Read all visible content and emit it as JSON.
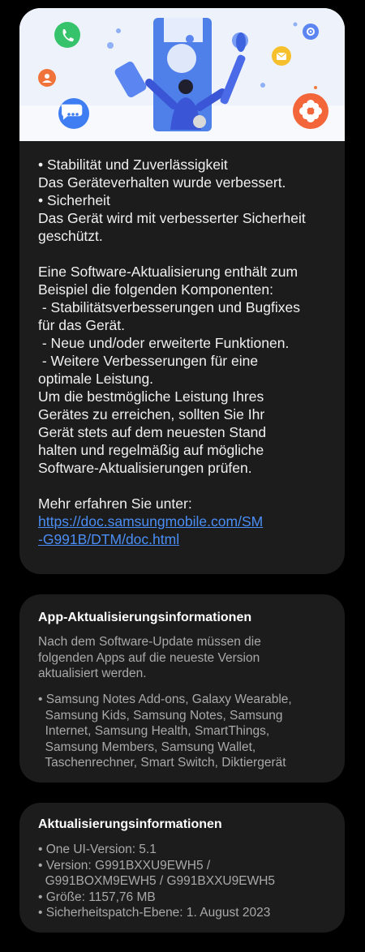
{
  "notes": {
    "lines": [
      "• Stabilität und Zuverlässigkeit",
      "Das Geräteverhalten wurde verbessert.",
      "• Sicherheit",
      "Das Gerät wird mit verbesserter Sicherheit",
      "geschützt.",
      "",
      "Eine Software-Aktualisierung enthält zum",
      "Beispiel die folgenden Komponenten:",
      " - Stabilitätsverbesserungen und Bugfixes",
      "für das Gerät.",
      " - Neue und/oder erweiterte Funktionen.",
      " - Weitere Verbesserungen für eine",
      "optimale Leistung.",
      "Um die bestmögliche Leistung Ihres",
      "Gerätes zu erreichen, sollten Sie Ihr",
      "Gerät stets auf dem neuesten Stand",
      "halten und regelmäßig auf mögliche",
      "Software-Aktualisierungen prüfen.",
      "",
      "Mehr erfahren Sie unter:"
    ],
    "link_line1": "https://doc.samsungmobile.com/SM",
    "link_line2": "-G991B/DTM/doc.html"
  },
  "apps_section": {
    "title": "App-Aktualisierungsinformationen",
    "description_lines": [
      "Nach dem Software-Update müssen die",
      "folgenden Apps auf die neueste Version",
      "aktualisiert werden."
    ],
    "list_lines": [
      "• Samsung Notes Add-ons, Galaxy Wearable,",
      "  Samsung Kids, Samsung Notes, Samsung",
      "  Internet, Samsung Health, SmartThings,",
      "  Samsung Members, Samsung Wallet,",
      "  Taschenrechner, Smart Switch, Diktiergerät"
    ]
  },
  "update_section": {
    "title": "Aktualisierungsinformationen",
    "lines": [
      "• One UI-Version: 5.1",
      "• Version: G991BXXU9EWH5 /",
      "  G991BOXM9EWH5 / G991BXXU9EWH5",
      "• Größe: 1157,76 MB",
      "• Sicherheitspatch-Ebene: 1. August 2023"
    ]
  },
  "colors": {
    "background": "#000000",
    "card": "#1c1c1c",
    "link": "#4a8ef5",
    "secondary_text": "#a9a9a9"
  },
  "icons": [
    "phone-icon",
    "chat-icon",
    "flower-icon",
    "mail-icon",
    "gear-icon",
    "person-icon"
  ]
}
